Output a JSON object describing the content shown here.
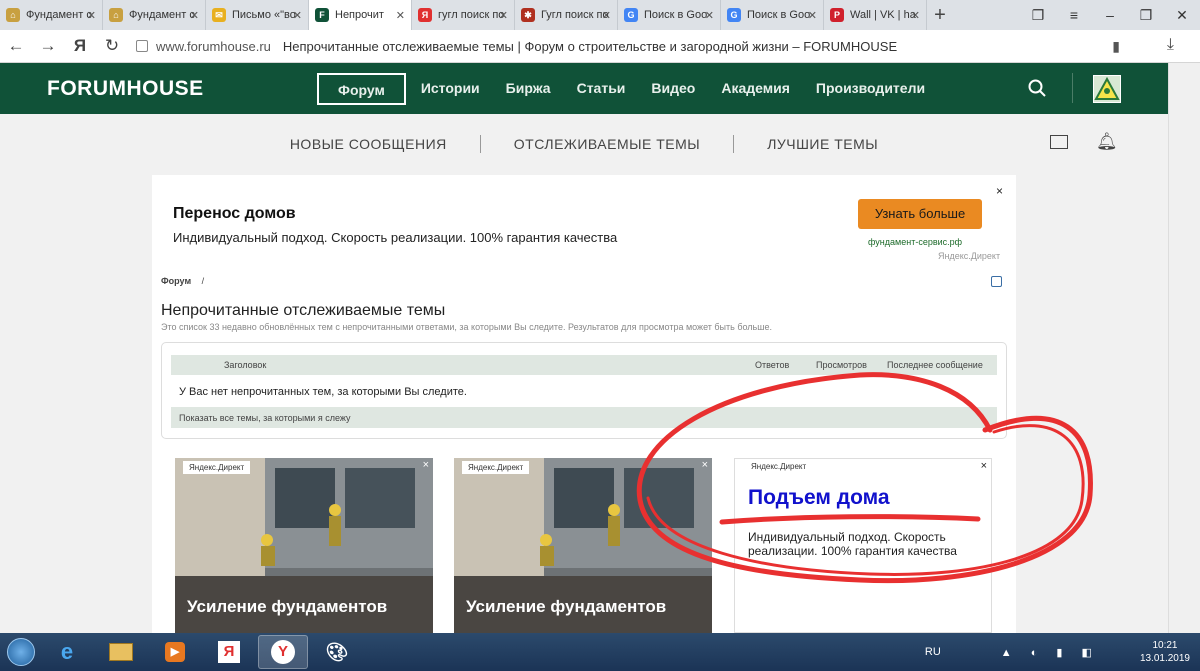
{
  "browser": {
    "tabs": [
      {
        "label": "Фундамент с",
        "icon": "house-icon",
        "color": "#c8a040"
      },
      {
        "label": "Фундамент с",
        "icon": "house-icon",
        "color": "#c8a040"
      },
      {
        "label": "Письмо «\"во",
        "icon": "mail-icon",
        "color": "#e8b020"
      },
      {
        "label": "Непрочит",
        "icon": "forumhouse-icon",
        "color": "#105238",
        "active": true
      },
      {
        "label": "гугл поиск по",
        "icon": "yandex-icon",
        "color": "#e03030"
      },
      {
        "label": "Гугл поиск по",
        "icon": "bug-icon",
        "color": "#b03020"
      },
      {
        "label": "Поиск в Goo",
        "icon": "google-icon",
        "color": "#4285f4"
      },
      {
        "label": "Поиск в Goo",
        "icon": "google-icon",
        "color": "#4285f4"
      },
      {
        "label": "Wall | VK | ha",
        "icon": "pinterest-icon",
        "color": "#d0202c"
      }
    ],
    "new_tab": "+",
    "url_host": "www.forumhouse.ru",
    "page_title": "Непрочитанные отслеживаемые темы | Форум о строительстве и загородной жизни – FORUMHOUSE"
  },
  "site": {
    "logo": "FORUMHOUSE",
    "nav": [
      "Форум",
      "Истории",
      "Биржа",
      "Статьи",
      "Видео",
      "Академия",
      "Производители"
    ],
    "subnav": [
      "НОВЫЕ СООБЩЕНИЯ",
      "ОТСЛЕЖИВАЕМЫЕ ТЕМЫ",
      "ЛУЧШИЕ ТЕМЫ"
    ]
  },
  "top_ad": {
    "title": "Перенос домов",
    "text": "Индивидуальный подход. Скорость реализации. 100% гарантия качества",
    "button": "Узнать больше",
    "domain": "фундамент-сервис.рф",
    "provider": "Яндекс.Директ",
    "close": "×"
  },
  "page": {
    "breadcrumb": "Форум",
    "breadcrumb_sep": "/",
    "title": "Непрочитанные отслеживаемые темы",
    "description": "Это список 33 недавно обновлённых тем с непрочитанными ответами, за которыми Вы следите. Результатов для просмотра может быть больше.",
    "table": {
      "headers": [
        "Заголовок",
        "Ответов",
        "Просмотров",
        "Последнее сообщение"
      ],
      "empty": "У Вас нет непрочитанных тем, за которыми Вы следите.",
      "footer_link": "Показать все темы, за которыми я слежу"
    }
  },
  "bottom_ads": [
    {
      "label": "Яндекс.Директ",
      "caption": "Усиление фундаментов",
      "close": "×"
    },
    {
      "label": "Яндекс.Директ",
      "caption": "Усиление фундаментов",
      "close": "×"
    },
    {
      "label": "Яндекс.Директ",
      "title": "Подъем дома",
      "text": "Индивидуальный подход. Скорость реализации. 100% гарантия качества",
      "close": "×"
    }
  ],
  "taskbar": {
    "lang": "RU",
    "time": "10:21",
    "date": "13.01.2019"
  }
}
